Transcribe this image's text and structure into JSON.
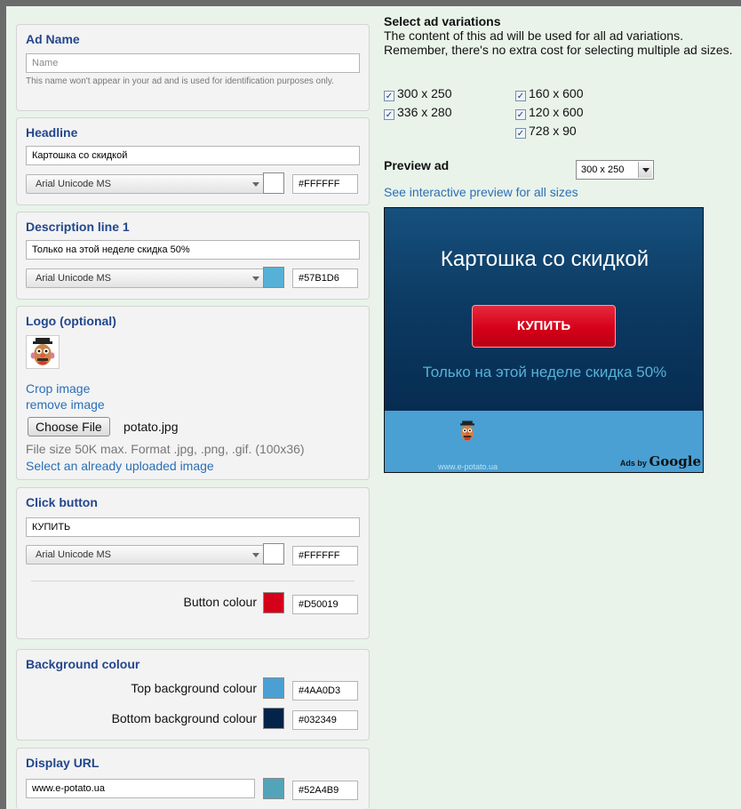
{
  "ad_name": {
    "title": "Ad Name",
    "placeholder": "Name",
    "help": "This name won't appear in your ad and is used for identification purposes only."
  },
  "headline": {
    "title": "Headline",
    "value": "Картошка со скидкой",
    "font": "Arial Unicode MS",
    "color_hex": "#FFFFFF",
    "swatch": "#FFFFFF"
  },
  "description": {
    "title": "Description line 1",
    "value": "Только на этой неделе скидка 50%",
    "font": "Arial Unicode MS",
    "color_hex": "#57B1D6",
    "swatch": "#57B1D6"
  },
  "logo": {
    "title": "Logo (optional)",
    "crop_link": "Crop image",
    "remove_link": "remove image",
    "choose_file_label": "Choose File",
    "file_name": "potato.jpg",
    "file_info": "File size 50K max. Format .jpg, .png, .gif. (100x36)",
    "select_uploaded_link": "Select an already uploaded image",
    "icon": "potato-head-icon"
  },
  "click_button": {
    "title": "Click button",
    "value": "КУПИТЬ",
    "font": "Arial Unicode MS",
    "text_color_hex": "#FFFFFF",
    "text_swatch": "#FFFFFF",
    "button_colour_label": "Button colour",
    "button_color_hex": "#D50019",
    "button_swatch": "#D50019"
  },
  "background": {
    "title": "Background colour",
    "top_label": "Top background colour",
    "top_hex": "#4AA0D3",
    "top_swatch": "#4AA0D3",
    "bottom_label": "Bottom background colour",
    "bottom_hex": "#032349",
    "bottom_swatch": "#032349"
  },
  "display_url": {
    "title": "Display URL",
    "value": "www.e-potato.ua",
    "color_hex": "#52A4B9",
    "swatch": "#52A4B9"
  },
  "variations": {
    "title": "Select ad variations",
    "description": "The content of this ad will be used for all ad variations. Remember, there's no extra cost for selecting multiple ad sizes.",
    "sizes": [
      {
        "label": "300 x 250",
        "checked": true
      },
      {
        "label": "336 x 280",
        "checked": true
      },
      {
        "label": "160 x 600",
        "checked": true
      },
      {
        "label": "120 x 600",
        "checked": true
      },
      {
        "label": "728 x 90",
        "checked": true
      }
    ]
  },
  "preview": {
    "title": "Preview ad",
    "size_selected": "300 x 250",
    "interactive_link": "See interactive preview for all sizes",
    "ad_headline": "Картошка со скидкой",
    "ad_button": "КУПИТЬ",
    "ad_description": "Только на этой неделе скидка 50%",
    "ad_url": "www.e-potato.ua",
    "ads_by": "Ads by",
    "ads_by_brand": "Google"
  }
}
